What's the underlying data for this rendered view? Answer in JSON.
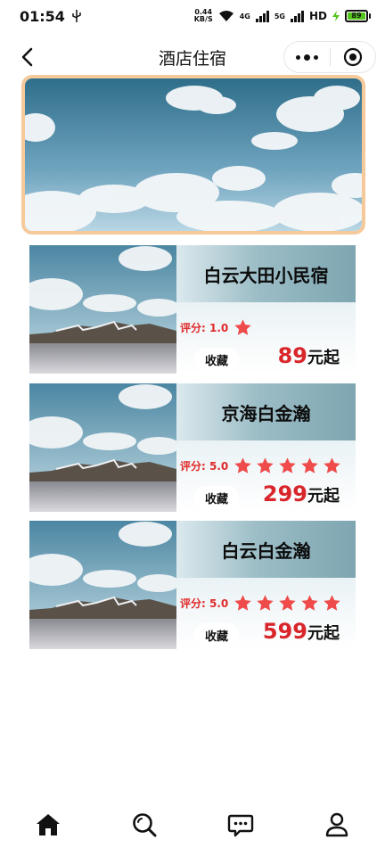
{
  "status_bar": {
    "time": "01:54",
    "net_speed_value": "0.44",
    "net_speed_unit": "KB/S",
    "network_1": "4G",
    "network_2": "5G",
    "hd": "HD",
    "battery": "89"
  },
  "nav": {
    "title": "酒店住宿"
  },
  "hotels": [
    {
      "name": "白云大田小民宿",
      "rating_label": "评分: 1.0",
      "rating": 1,
      "favorite_label": "收藏",
      "price": "89",
      "price_unit": "元起"
    },
    {
      "name": "京海白金瀚",
      "rating_label": "评分: 5.0",
      "rating": 5,
      "favorite_label": "收藏",
      "price": "299",
      "price_unit": "元起"
    },
    {
      "name": "白云白金瀚",
      "rating_label": "评分: 5.0",
      "rating": 5,
      "favorite_label": "收藏",
      "price": "599",
      "price_unit": "元起"
    }
  ],
  "tabs": [
    {
      "icon": "home-icon"
    },
    {
      "icon": "search-icon"
    },
    {
      "icon": "message-icon"
    },
    {
      "icon": "user-icon"
    }
  ],
  "colors": {
    "accent_red": "#d9262b",
    "star_red": "#ef4b4b",
    "banner_border": "#f5c99a",
    "battery_green": "#52c41a"
  }
}
